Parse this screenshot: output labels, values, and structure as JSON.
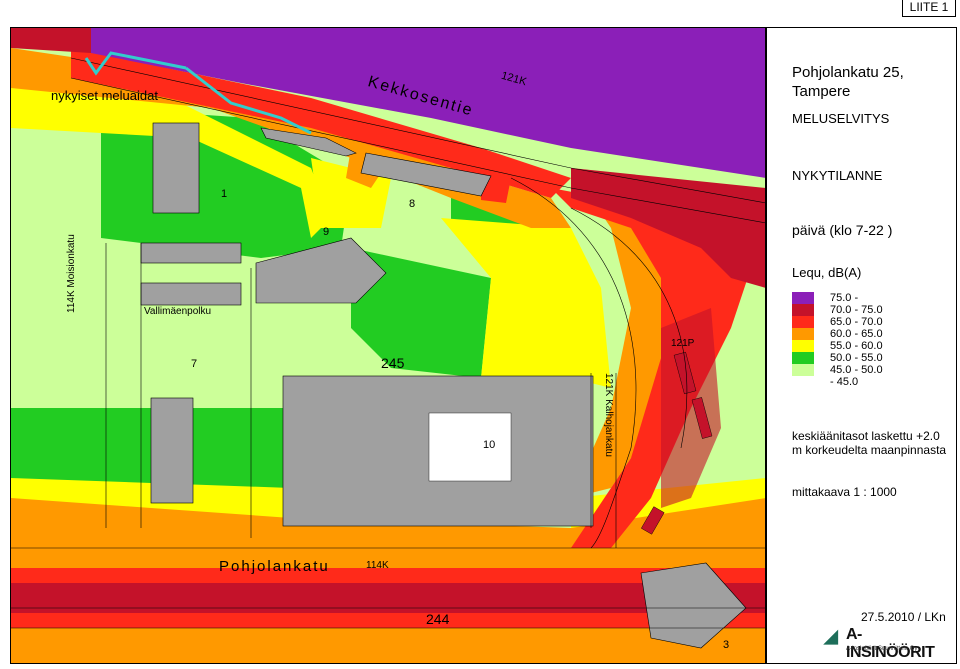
{
  "appendix_label": "LIITE 1",
  "title": "Pohjolankatu 25, Tampere",
  "subtitle": "MELUSELVITYS",
  "scenario": "NYKYTILANNE",
  "period": "päivä (klo 7-22 )",
  "metric": "Lequ, dB(A)",
  "legend": [
    {
      "label": "75.0 -",
      "color": "#8b1fb8"
    },
    {
      "label": "70.0 - 75.0",
      "color": "#c4122a"
    },
    {
      "label": "65.0 - 70.0",
      "color": "#ff2a1a"
    },
    {
      "label": "60.0 - 65.0",
      "color": "#ff9900"
    },
    {
      "label": "55.0 - 60.0",
      "color": "#ffff00"
    },
    {
      "label": "50.0 - 55.0",
      "color": "#22cc22"
    },
    {
      "label": "45.0 - 50.0",
      "color": "#ccff99"
    },
    {
      "label": "- 45.0",
      "color": "#ffffff"
    }
  ],
  "note": "keskiäänitasot laskettu +2.0 m korkeudelta maanpinnasta",
  "scale": "mittakaava 1 : 1000",
  "date_author": "27.5.2010 / LKn",
  "logo_text": "A-INSINÖÖRIT",
  "logo_sub": "A-Insinöörit Suunnittelu Oy",
  "map_labels": {
    "existing_walls": "nykyiset meluaidat",
    "kekkosentie": "Kekkosentie",
    "pohjolankatu": "Pohjolankatu",
    "moisionkatu": "114K Moisionkatu",
    "vallimaenpolku": "Vallimäenpolku",
    "kalhojankatu": "121K Kalhojankatu",
    "block_245": "245",
    "block_244": "244",
    "code_121k": "121K",
    "code_114k": "114K",
    "code_121p": "121P",
    "num_1": "1",
    "num_7": "7",
    "num_8": "8",
    "num_9": "9",
    "num_10": "10",
    "num_3": "3"
  }
}
